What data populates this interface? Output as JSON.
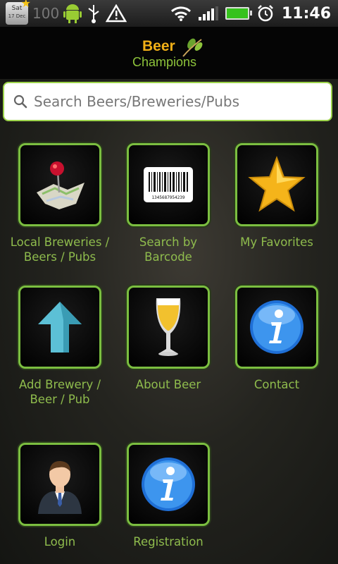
{
  "status_bar": {
    "calendar": {
      "day": "Sat",
      "date": "17 Dec"
    },
    "battery_number": "100",
    "time": "11:46"
  },
  "header": {
    "logo_top": "Beer",
    "logo_bottom": "Champions"
  },
  "search": {
    "placeholder": "Search Beers/Breweries/Pubs",
    "value": ""
  },
  "tiles": [
    {
      "icon": "map-pin-icon",
      "line1": "Local Breweries /",
      "line2": "Beers / Pubs"
    },
    {
      "icon": "barcode-icon",
      "line1": "Search by",
      "line2": "Barcode",
      "barcode_number": "1345687954239"
    },
    {
      "icon": "star-icon",
      "line1": "My Favorites",
      "line2": ""
    },
    {
      "icon": "up-arrow-icon",
      "line1": "Add Brewery /",
      "line2": "Beer / Pub"
    },
    {
      "icon": "beer-glass-icon",
      "line1": "About Beer",
      "line2": ""
    },
    {
      "icon": "info-icon",
      "line1": "Contact",
      "line2": ""
    },
    {
      "icon": "user-icon",
      "line1": "Login",
      "line2": ""
    },
    {
      "icon": "info-icon",
      "line1": "Registration",
      "line2": ""
    }
  ],
  "colors": {
    "accent_green": "#7bbe40",
    "label_green": "#8fbc4d",
    "logo_yellow": "#f2b017"
  }
}
